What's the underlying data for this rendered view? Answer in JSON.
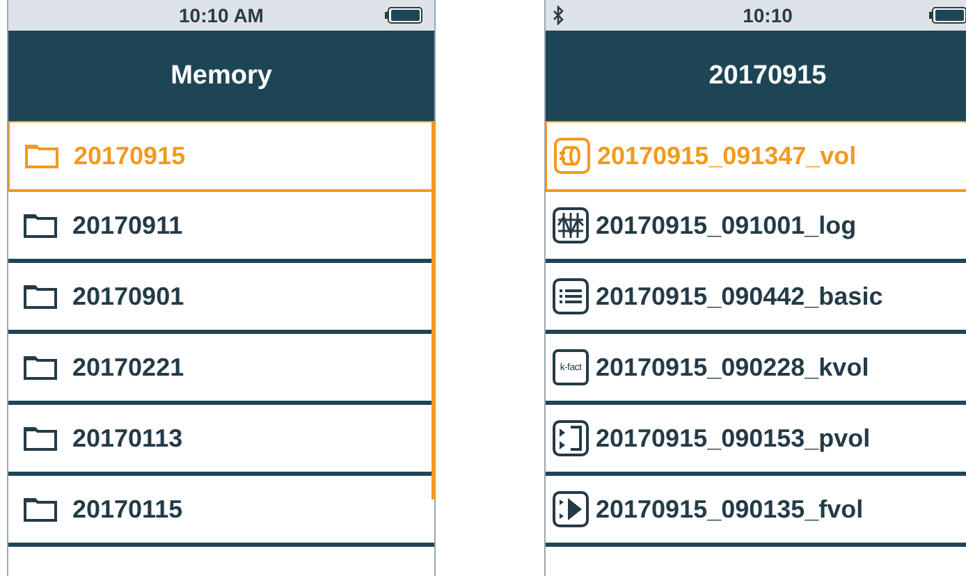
{
  "screens": [
    {
      "status_bar": {
        "time": "10:10 AM",
        "bluetooth": false
      },
      "title": "Memory",
      "scrollbar": true,
      "items": [
        {
          "label": "20170915",
          "kind": "folder",
          "selected": true
        },
        {
          "label": "20170911",
          "kind": "folder",
          "selected": false
        },
        {
          "label": "20170901",
          "kind": "folder",
          "selected": false
        },
        {
          "label": "20170221",
          "kind": "folder",
          "selected": false
        },
        {
          "label": "20170113",
          "kind": "folder",
          "selected": false
        },
        {
          "label": "20170115",
          "kind": "folder",
          "selected": false
        }
      ]
    },
    {
      "status_bar": {
        "time": "10:10",
        "bluetooth": true
      },
      "title": "20170915",
      "scrollbar": false,
      "items": [
        {
          "label": "20170915_091347_vol",
          "kind": "vol",
          "selected": true
        },
        {
          "label": "20170915_091001_log",
          "kind": "log",
          "selected": false
        },
        {
          "label": "20170915_090442_basic",
          "kind": "basic",
          "selected": false
        },
        {
          "label": "20170915_090228_kvol",
          "kind": "kfact",
          "icon_text": "k-fact",
          "selected": false
        },
        {
          "label": "20170915_090153_pvol",
          "kind": "pvol",
          "selected": false
        },
        {
          "label": "20170915_090135_fvol",
          "kind": "fvol",
          "selected": false
        }
      ]
    }
  ]
}
